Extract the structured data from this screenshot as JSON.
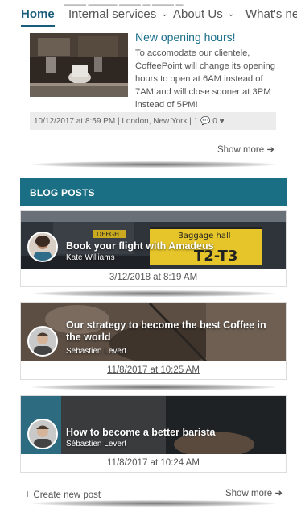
{
  "nav": {
    "items": [
      {
        "label": "Home",
        "active": true,
        "chevron": false
      },
      {
        "label": "Internal services",
        "active": false,
        "chevron": true
      },
      {
        "label": "About Us",
        "active": false,
        "chevron": true
      },
      {
        "label": "What's new",
        "active": false,
        "chevron": false
      }
    ]
  },
  "news": {
    "title": "New opening hours!",
    "body_lines": [
      "To accomodate our clientele,",
      "CoffeePoint will change its opening",
      "hours to open at 6AM instead of",
      "7AM and will close sooner at 3PM",
      "instead of 5PM!"
    ],
    "meta": "10/12/2017 at 8:59 PM | London, New York |",
    "comments": "1",
    "likes": "0",
    "show_more": "Show more"
  },
  "blog": {
    "header": "BLOG POSTS",
    "posts": [
      {
        "title_lines": [
          "Book your flight with Amadeus"
        ],
        "author": "Kate Williams",
        "date": "3/12/2018 at 8:19 AM"
      },
      {
        "title_lines": [
          "Our strategy to become the best Coffee in",
          "the world"
        ],
        "author": "Sebastien Levert",
        "date": "11/8/2017 at 10:25 AM"
      },
      {
        "title_lines": [
          "How to become a better barista"
        ],
        "author": "Sébastien Levert",
        "date": "11/8/2017 at 10:24 AM"
      }
    ],
    "create_label": "Create new post",
    "show_more": "Show more"
  },
  "colors": {
    "accent": "#1b6f85",
    "link": "#1a6f8a"
  }
}
